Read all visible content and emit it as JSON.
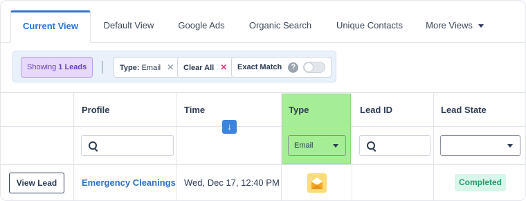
{
  "tabs": [
    {
      "label": "Current View",
      "active": true
    },
    {
      "label": "Default View",
      "active": false
    },
    {
      "label": "Google Ads",
      "active": false
    },
    {
      "label": "Organic Search",
      "active": false
    },
    {
      "label": "Unique Contacts",
      "active": false
    },
    {
      "label": "More Views",
      "active": false
    }
  ],
  "filters": {
    "showing_prefix": "Showing",
    "showing_count": "1 Leads",
    "type_label": "Type:",
    "type_value": "Email",
    "clear_all": "Clear All",
    "exact_match": "Exact Match",
    "exact_match_on": false,
    "help_glyph": "?"
  },
  "table": {
    "columns": [
      "Profile",
      "Time",
      "Type",
      "Lead ID",
      "Lead State"
    ],
    "sort_glyph": "↓",
    "type_filter_value": "Email",
    "lead_state_filter_value": "",
    "rows": [
      {
        "action": "View Lead",
        "profile": "Emergency Cleanings",
        "time": "Wed, Dec 17, 12:40 PM",
        "type_icon": "email-icon",
        "lead_id": "",
        "lead_state": "Completed"
      }
    ]
  },
  "colors": {
    "accent": "#2f74d0",
    "type_column_highlight": "#a6ee95",
    "completed_badge_bg": "#d9f6ea",
    "completed_badge_text": "#1f9d6b",
    "showing_chip_bg": "#e6d9fb"
  }
}
